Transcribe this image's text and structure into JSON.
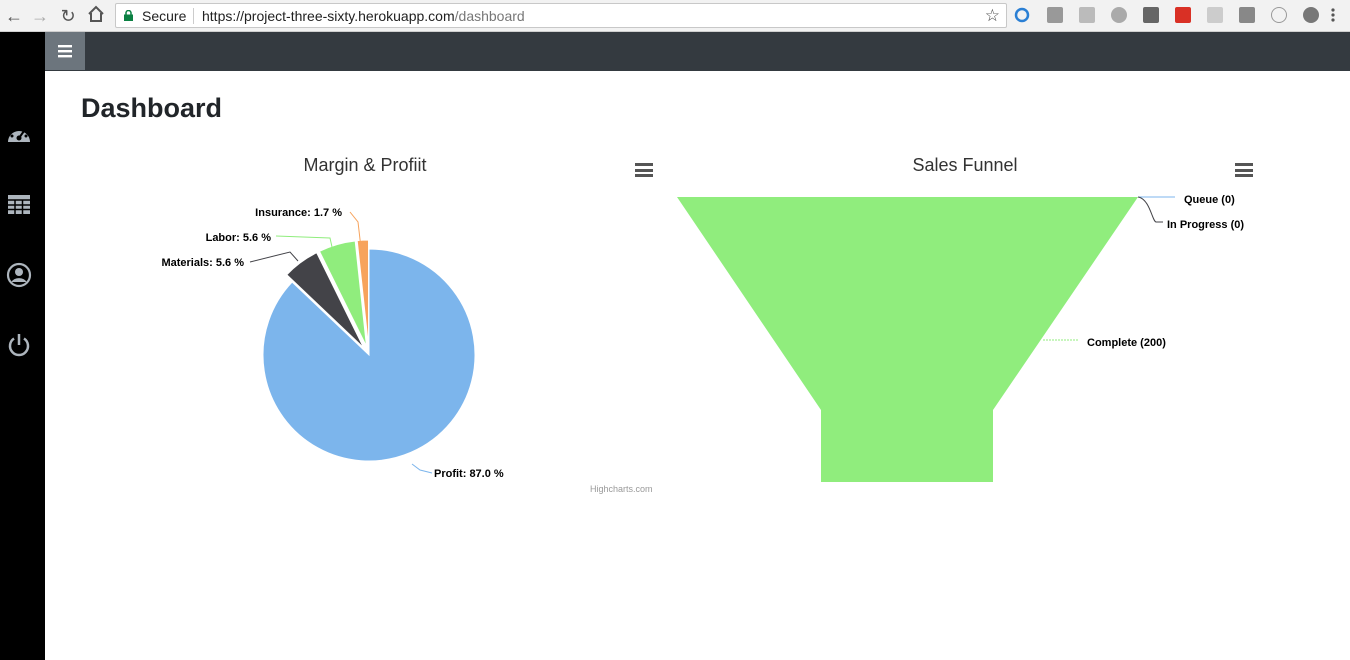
{
  "browser": {
    "secure_label": "Secure",
    "url_host": "https://project-three-sixty.herokuapp.com",
    "url_path": "/dashboard"
  },
  "page": {
    "title": "Dashboard"
  },
  "margin_chart": {
    "title": "Margin & Profiit",
    "credits": "Highcharts.com",
    "colors": {
      "Profit": "#7cb5ec",
      "Materials": "#434348",
      "Labor": "#90ed7d",
      "Insurance": "#f7a35c"
    }
  },
  "funnel_chart": {
    "title": "Sales Funnel",
    "color": "#90ed7d"
  },
  "chart_data": [
    {
      "type": "pie",
      "title": "Margin & Profiit",
      "categories": [
        "Profit",
        "Materials",
        "Labor",
        "Insurance"
      ],
      "values": [
        87.0,
        5.6,
        5.6,
        1.7
      ],
      "labels": [
        "Profit: 87.0 %",
        "Materials: 5.6 %",
        "Labor: 5.6 %",
        "Insurance: 1.7 %"
      ]
    },
    {
      "type": "funnel",
      "title": "Sales Funnel",
      "categories": [
        "Queue",
        "In Progress",
        "Complete"
      ],
      "values": [
        0,
        0,
        200
      ],
      "labels": [
        "Queue (0)",
        "In Progress (0)",
        "Complete (200)"
      ]
    }
  ]
}
